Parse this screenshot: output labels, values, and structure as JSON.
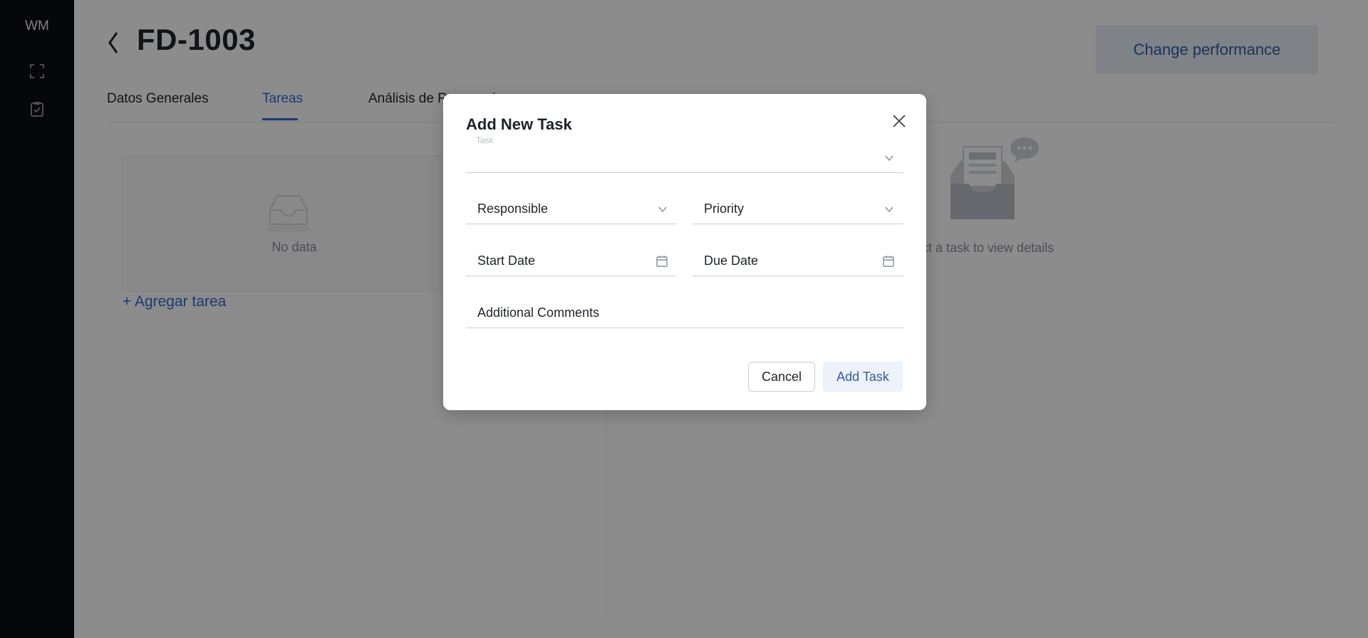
{
  "sidebar": {
    "logo": "WM",
    "icons": [
      "fullscreen-icon",
      "clipboard-check-icon"
    ]
  },
  "header": {
    "title": "FD-1003",
    "performance_button": "Change performance"
  },
  "tabs": [
    {
      "label": "Datos Generales",
      "active": false
    },
    {
      "label": "Tareas",
      "active": true
    },
    {
      "label": "Análisis de Reservorio",
      "active": false
    }
  ],
  "task_list": {
    "empty_text": "No data",
    "add_link": "+ Agregar tarea"
  },
  "task_detail": {
    "empty_text": "ect a task to view details"
  },
  "modal": {
    "title": "Add New Task",
    "task_label": "Task",
    "responsible_label": "Responsible",
    "priority_label": "Priority",
    "start_date_label": "Start Date",
    "due_date_label": "Due Date",
    "comments_label": "Additional Comments",
    "cancel_label": "Cancel",
    "add_label": "Add Task"
  },
  "colors": {
    "accent": "#2f6bd6",
    "sidebar": "#0a0d12",
    "overlay": "rgba(0,0,0,0.45)"
  }
}
